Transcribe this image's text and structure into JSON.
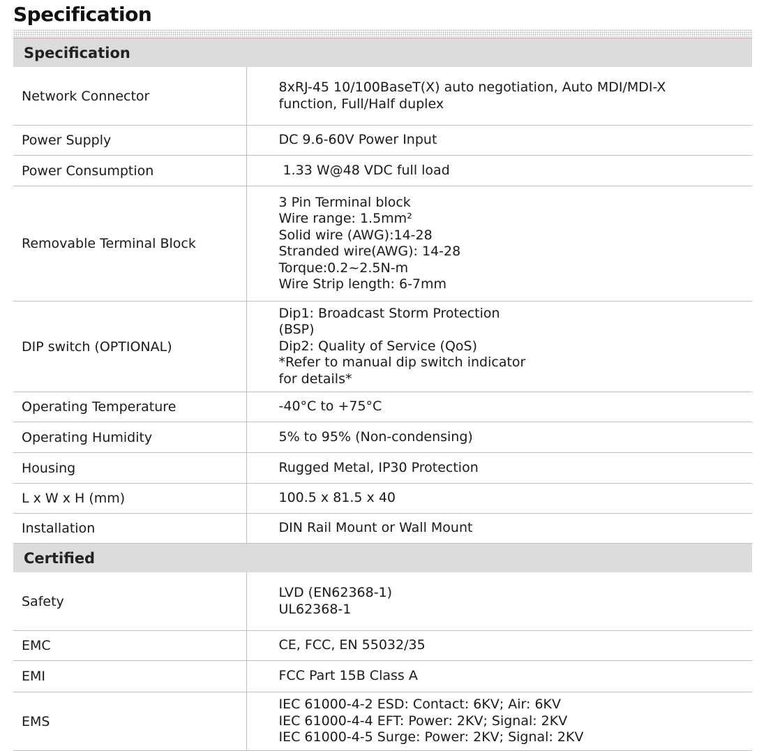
{
  "page_title": "Specification",
  "sections": [
    {
      "header": "Specification",
      "rows": [
        {
          "label": "Network Connector",
          "value": [
            "8xRJ-45 10/100BaseT(X) auto negotiation, Auto MDI/MDI-X",
            "function, Full/Half duplex"
          ]
        },
        {
          "label": "Power Supply",
          "value": [
            "DC 9.6-60V Power Input"
          ]
        },
        {
          "label": "Power Consumption",
          "value": [
            " 1.33 W@48 VDC full load"
          ]
        },
        {
          "label": "Removable Terminal Block",
          "value": [
            "3 Pin Terminal block",
            "Wire range: 1.5mm²",
            "Solid wire (AWG):14-28",
            "Stranded wire(AWG): 14-28",
            "Torque:0.2~2.5N-m",
            "Wire Strip length: 6-7mm"
          ]
        },
        {
          "label": "DIP switch (OPTIONAL)",
          "value": [
            "Dip1: Broadcast Storm Protection",
            "(BSP)",
            "Dip2: Quality of Service (QoS)",
            "*Refer to manual dip switch indicator",
            "for details*"
          ]
        },
        {
          "label": "Operating Temperature",
          "value": [
            "-40°C to +75°C"
          ]
        },
        {
          "label": "Operating Humidity",
          "value": [
            "5% to 95% (Non-condensing)"
          ]
        },
        {
          "label": "Housing",
          "value": [
            "Rugged Metal, IP30 Protection"
          ]
        },
        {
          "label": "L x W x H (mm)",
          "value": [
            "100.5 x 81.5 x 40"
          ]
        },
        {
          "label": "Installation",
          "value": [
            "DIN Rail Mount or Wall Mount"
          ]
        }
      ]
    },
    {
      "header": "Certified",
      "rows": [
        {
          "label": "Safety",
          "value": [
            "LVD (EN62368-1)",
            "UL62368-1"
          ]
        },
        {
          "label": "EMC",
          "value": [
            "CE, FCC, EN 55032/35"
          ]
        },
        {
          "label": "EMI",
          "value": [
            "FCC Part 15B Class A"
          ]
        },
        {
          "label": "EMS",
          "value": [
            "IEC 61000-4-2 ESD: Contact: 6KV; Air: 6KV",
            "IEC 61000-4-4 EFT: Power: 2KV; Signal: 2KV",
            "IEC 61000-4-5 Surge: Power: 2KV; Signal: 2KV"
          ]
        }
      ]
    }
  ]
}
